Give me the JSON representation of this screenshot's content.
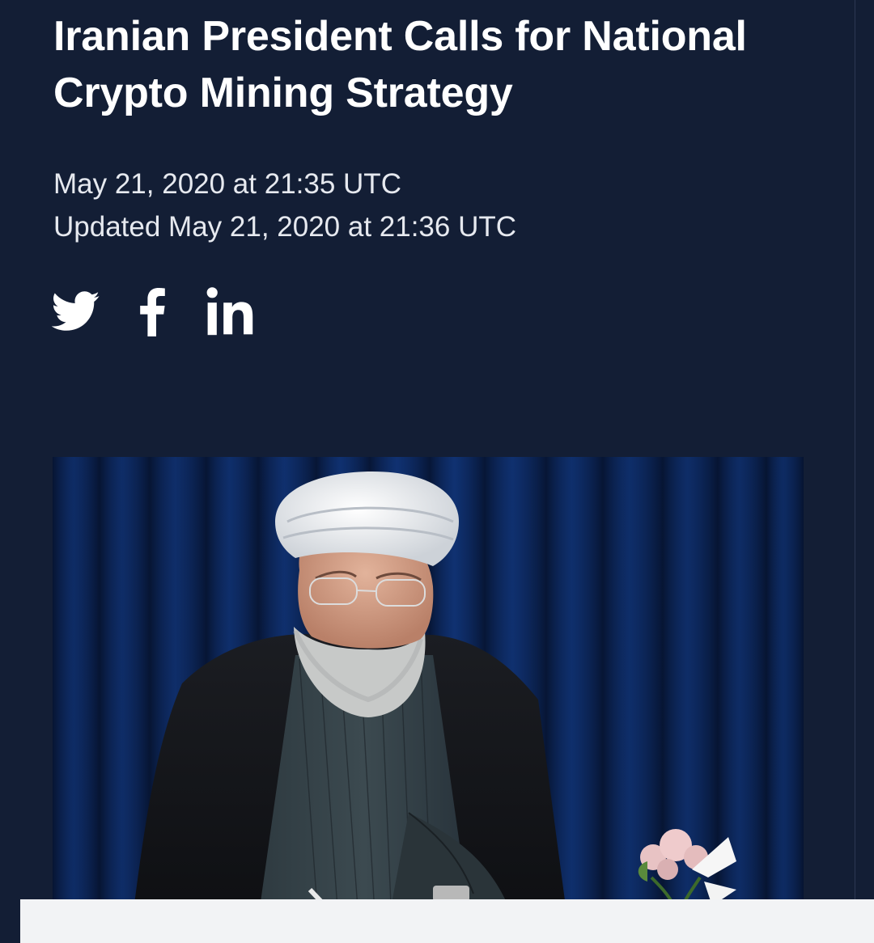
{
  "article": {
    "title": "Iranian President Calls for National Crypto Mining Strategy",
    "published": "May 21, 2020 at 21:35 UTC",
    "updated": "Updated May 21, 2020 at 21:36 UTC"
  },
  "share": {
    "buttons": [
      {
        "network": "Twitter",
        "icon": "twitter-icon"
      },
      {
        "network": "Facebook",
        "icon": "facebook-icon"
      },
      {
        "network": "LinkedIn",
        "icon": "linkedin-icon"
      }
    ]
  },
  "hero_image": {
    "subject": "photo-man-in-white-turban-signing-document"
  },
  "colors": {
    "background": "#131e35",
    "text": "#ffffff",
    "meta_text": "#e6e9ef",
    "curtain": "#0b2350",
    "panel": "#f2f3f5"
  }
}
